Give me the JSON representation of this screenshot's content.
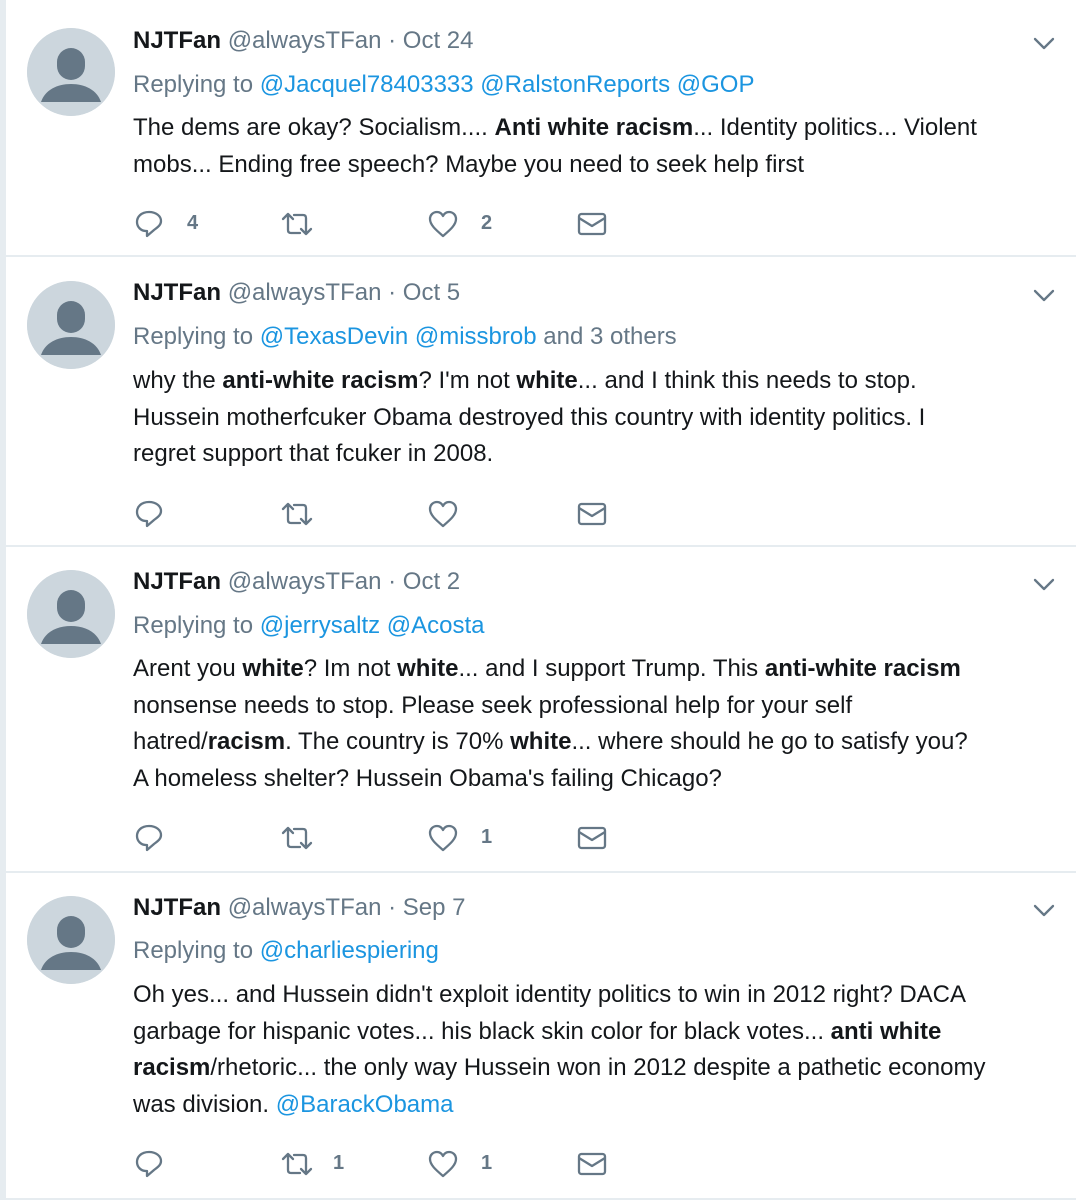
{
  "tweets": [
    {
      "name": "NJTFan",
      "handle": "@alwaysTFan",
      "separator": "·",
      "date": "Oct 24",
      "replying_prefix": "Replying to",
      "replying_to": [
        "@Jacquel78403333",
        "@RalstonReports",
        "@GOP"
      ],
      "replying_suffix": "",
      "lines": [
        [
          {
            "t": "The dems are okay? Socialism.... "
          },
          {
            "t": "Anti white racism",
            "b": true
          },
          {
            "t": "... Identity politics... Violent"
          }
        ],
        [
          {
            "t": "mobs... Ending free speech? Maybe you need to seek help first"
          }
        ]
      ],
      "counts": {
        "reply": "4",
        "retweet": "",
        "like": "2"
      }
    },
    {
      "name": "NJTFan",
      "handle": "@alwaysTFan",
      "separator": "·",
      "date": "Oct 5",
      "replying_prefix": "Replying to",
      "replying_to": [
        "@TexasDevin",
        "@missbrob"
      ],
      "replying_suffix": "and 3 others",
      "lines": [
        [
          {
            "t": "why the "
          },
          {
            "t": "anti-white racism",
            "b": true
          },
          {
            "t": "? I'm not "
          },
          {
            "t": "white",
            "b": true
          },
          {
            "t": "... and I think this needs to stop."
          }
        ],
        [
          {
            "t": "Hussein motherfcuker Obama destroyed this country with identity politics. I"
          }
        ],
        [
          {
            "t": "regret support that fcuker in 2008."
          }
        ]
      ],
      "counts": {
        "reply": "",
        "retweet": "",
        "like": ""
      }
    },
    {
      "name": "NJTFan",
      "handle": "@alwaysTFan",
      "separator": "·",
      "date": "Oct 2",
      "replying_prefix": "Replying to",
      "replying_to": [
        "@jerrysaltz",
        "@Acosta"
      ],
      "replying_suffix": "",
      "lines": [
        [
          {
            "t": "Arent you "
          },
          {
            "t": "white",
            "b": true
          },
          {
            "t": "? Im not "
          },
          {
            "t": "white",
            "b": true
          },
          {
            "t": "... and I support Trump. This "
          },
          {
            "t": "anti-white racism",
            "b": true
          }
        ],
        [
          {
            "t": "nonsense needs to stop. Please seek professional help for your self"
          }
        ],
        [
          {
            "t": "hatred/"
          },
          {
            "t": "racism",
            "b": true
          },
          {
            "t": ". The country is 70% "
          },
          {
            "t": "white",
            "b": true
          },
          {
            "t": "... where should he go to satisfy you?"
          }
        ],
        [
          {
            "t": "A homeless shelter? Hussein Obama's failing Chicago?"
          }
        ]
      ],
      "counts": {
        "reply": "",
        "retweet": "",
        "like": "1"
      }
    },
    {
      "name": "NJTFan",
      "handle": "@alwaysTFan",
      "separator": "·",
      "date": "Sep 7",
      "replying_prefix": "Replying to",
      "replying_to": [
        "@charliespiering"
      ],
      "replying_suffix": "",
      "lines": [
        [
          {
            "t": "Oh yes... and Hussein didn't exploit identity politics to win in 2012 right? DACA"
          }
        ],
        [
          {
            "t": "garbage for hispanic votes... his black skin color for black votes... "
          },
          {
            "t": "anti white",
            "b": true
          }
        ],
        [
          {
            "t": "racism",
            "b": true
          },
          {
            "t": "/rhetoric... the only way Hussein won in 2012 despite a pathetic economy"
          }
        ],
        [
          {
            "t": "was division. "
          },
          {
            "t": "@BarackObama",
            "m": true
          }
        ]
      ],
      "counts": {
        "reply": "",
        "retweet": "1",
        "like": "1"
      }
    }
  ],
  "icons": {
    "avatar": "default-avatar-icon",
    "menu": "chevron-down-icon",
    "reply": "reply-icon",
    "retweet": "retweet-icon",
    "like": "heart-icon",
    "dm": "envelope-icon"
  },
  "colors": {
    "text": "#14171a",
    "secondary": "#657786",
    "link": "#1b95e0",
    "divider": "#e6ecf0",
    "avatar_bg": "#ccd6dd",
    "avatar_fg": "#657786"
  }
}
